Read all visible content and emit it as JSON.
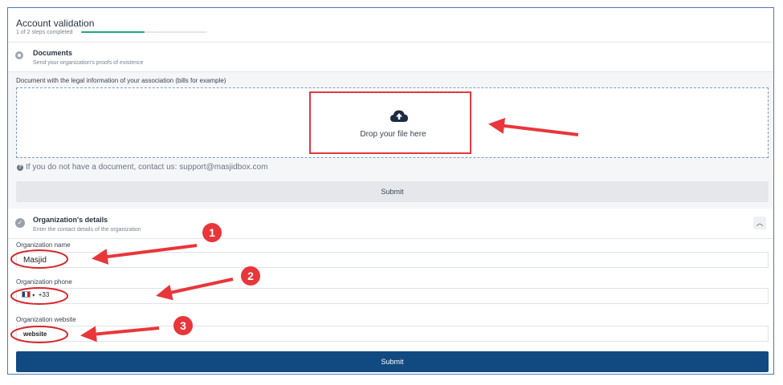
{
  "header": {
    "title": "Account validation",
    "steps": "1 of 2 steps completed",
    "progress": 0.5
  },
  "documents": {
    "title": "Documents",
    "subtitle": "Send your organization's proofs of existence",
    "field_label": "Document with the legal information of your association (bills for example)",
    "drop_text": "Drop your file here",
    "hint": "If you do not have a document, contact us: support@masjidbox.com",
    "submit": "Submit"
  },
  "details": {
    "title": "Organization's details",
    "subtitle": "Enter the contact details of the organization",
    "name_label": "Organization name",
    "name_value": "Masjid",
    "phone_label": "Organization phone",
    "phone_value": "+33",
    "website_label": "Organization website",
    "website_value": "website",
    "submit": "Submit"
  },
  "annotations": [
    "1",
    "2",
    "3"
  ],
  "colors": {
    "accent": "#114a80",
    "progress": "#1fa48a",
    "annotation": "#e8363b"
  }
}
